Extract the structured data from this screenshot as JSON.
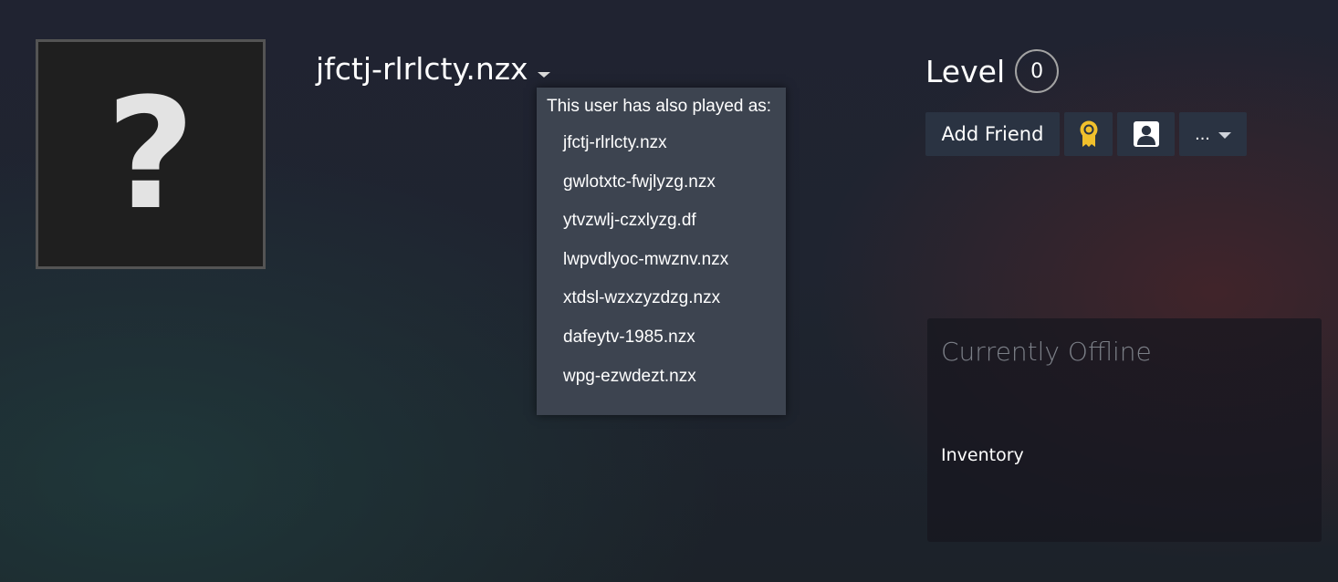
{
  "profile": {
    "avatar_glyph": "?",
    "persona_name": "jfctj-rlrlcty.nzx"
  },
  "aliases": {
    "title": "This user has also played as:",
    "items": [
      "jfctj-rlrlcty.nzx",
      "gwlotxtc-fwjlyzg.nzx",
      "ytvzwlj-czxlyzg.df",
      "lwpvdlyoc-mwznv.nzx",
      "xtdsl-wzxzyzdzg.nzx",
      "dafeytv-1985.nzx",
      "wpg-ezwdezt.nzx"
    ]
  },
  "level": {
    "label": "Level",
    "value": "0"
  },
  "actions": {
    "add_friend": "Add Friend",
    "badge_icon": "award-ribbon-icon",
    "profile_icon": "user-profile-icon",
    "more_label": "..."
  },
  "status": {
    "title": "Currently Offline",
    "inventory_link": "Inventory"
  },
  "colors": {
    "popup_bg": "#3d4450",
    "button_bg": "#2a3342",
    "award_gold": "#f1c02c",
    "status_title": "#7c8088"
  }
}
